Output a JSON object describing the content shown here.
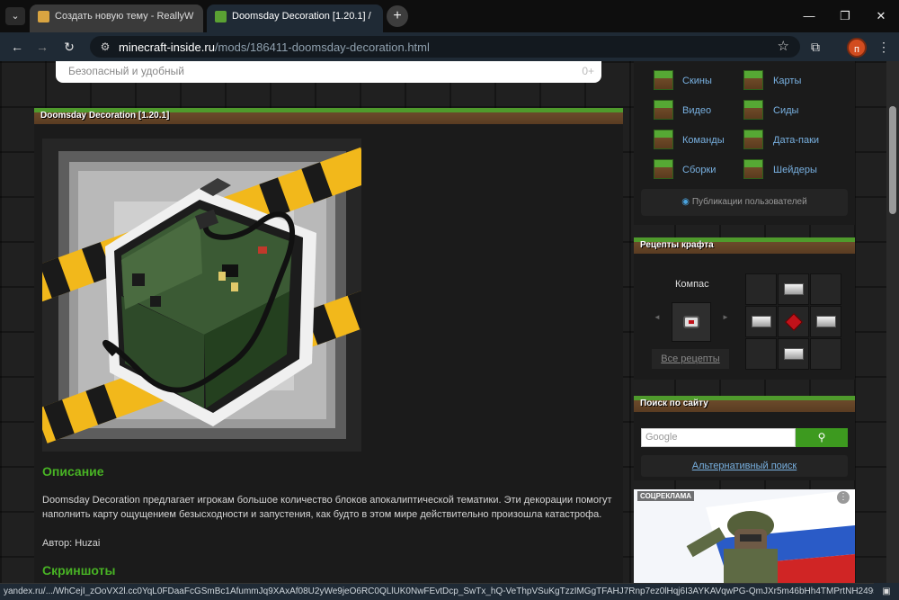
{
  "browser": {
    "tabs": [
      {
        "title": "Создать новую тему - ReallyW"
      },
      {
        "title": "Doomsday Decoration [1.20.1] /"
      }
    ],
    "new_tab": "+",
    "url_host": "minecraft-inside.ru",
    "url_path": "/mods/186411-doomsday-decoration.html",
    "profile_initial": "п",
    "status_url": "yandex.ru/.../WhCejI_zOoVX2l.cc0YqL0FDaaFcGSmBc1AfummJq9XAxAf08U2yWe9jeO6RC0QLlUK0NwFEvtDcp_SwTx_hQ-VeThpVSuKgTzzIMGgTFAHJ7Rnp7ez0lHqj6I3AYKAVqwPG-QmJXr5m46bHh4TMPrtNH249sm9JD7c..."
  },
  "search_dropdown": {
    "text": "Безопасный и удобный",
    "count": "0+"
  },
  "main": {
    "title_bar": "Doomsday Decoration [1.20.1]",
    "description_heading": "Описание",
    "description_text": "Doomsday Decoration предлагает игрокам большое количество блоков апокалиптической тематики. Эти декорации помогут наполнить карту ощущением безысходности и запустения, как будто в этом мире действительно произошла катастрофа.",
    "author": "Автор: Huzai",
    "screenshots_heading": "Скриншоты"
  },
  "sidebar": {
    "categories": [
      {
        "label": "Скины"
      },
      {
        "label": "Карты"
      },
      {
        "label": "Видео"
      },
      {
        "label": "Сиды"
      },
      {
        "label": "Команды"
      },
      {
        "label": "Дата-паки"
      },
      {
        "label": "Сборки"
      },
      {
        "label": "Шейдеры"
      }
    ],
    "user_posts": "Публикации пользователей",
    "recipes": {
      "heading": "Рецепты крафта",
      "item_name": "Компас",
      "all_recipes": "Все рецепты",
      "prev": "◄",
      "next": "►"
    },
    "site_search": {
      "heading": "Поиск по сайту",
      "placeholder": "Google",
      "alt_search": "Альтернативный поиск"
    },
    "ad": {
      "label": "СОЦРЕКЛАМА"
    }
  }
}
